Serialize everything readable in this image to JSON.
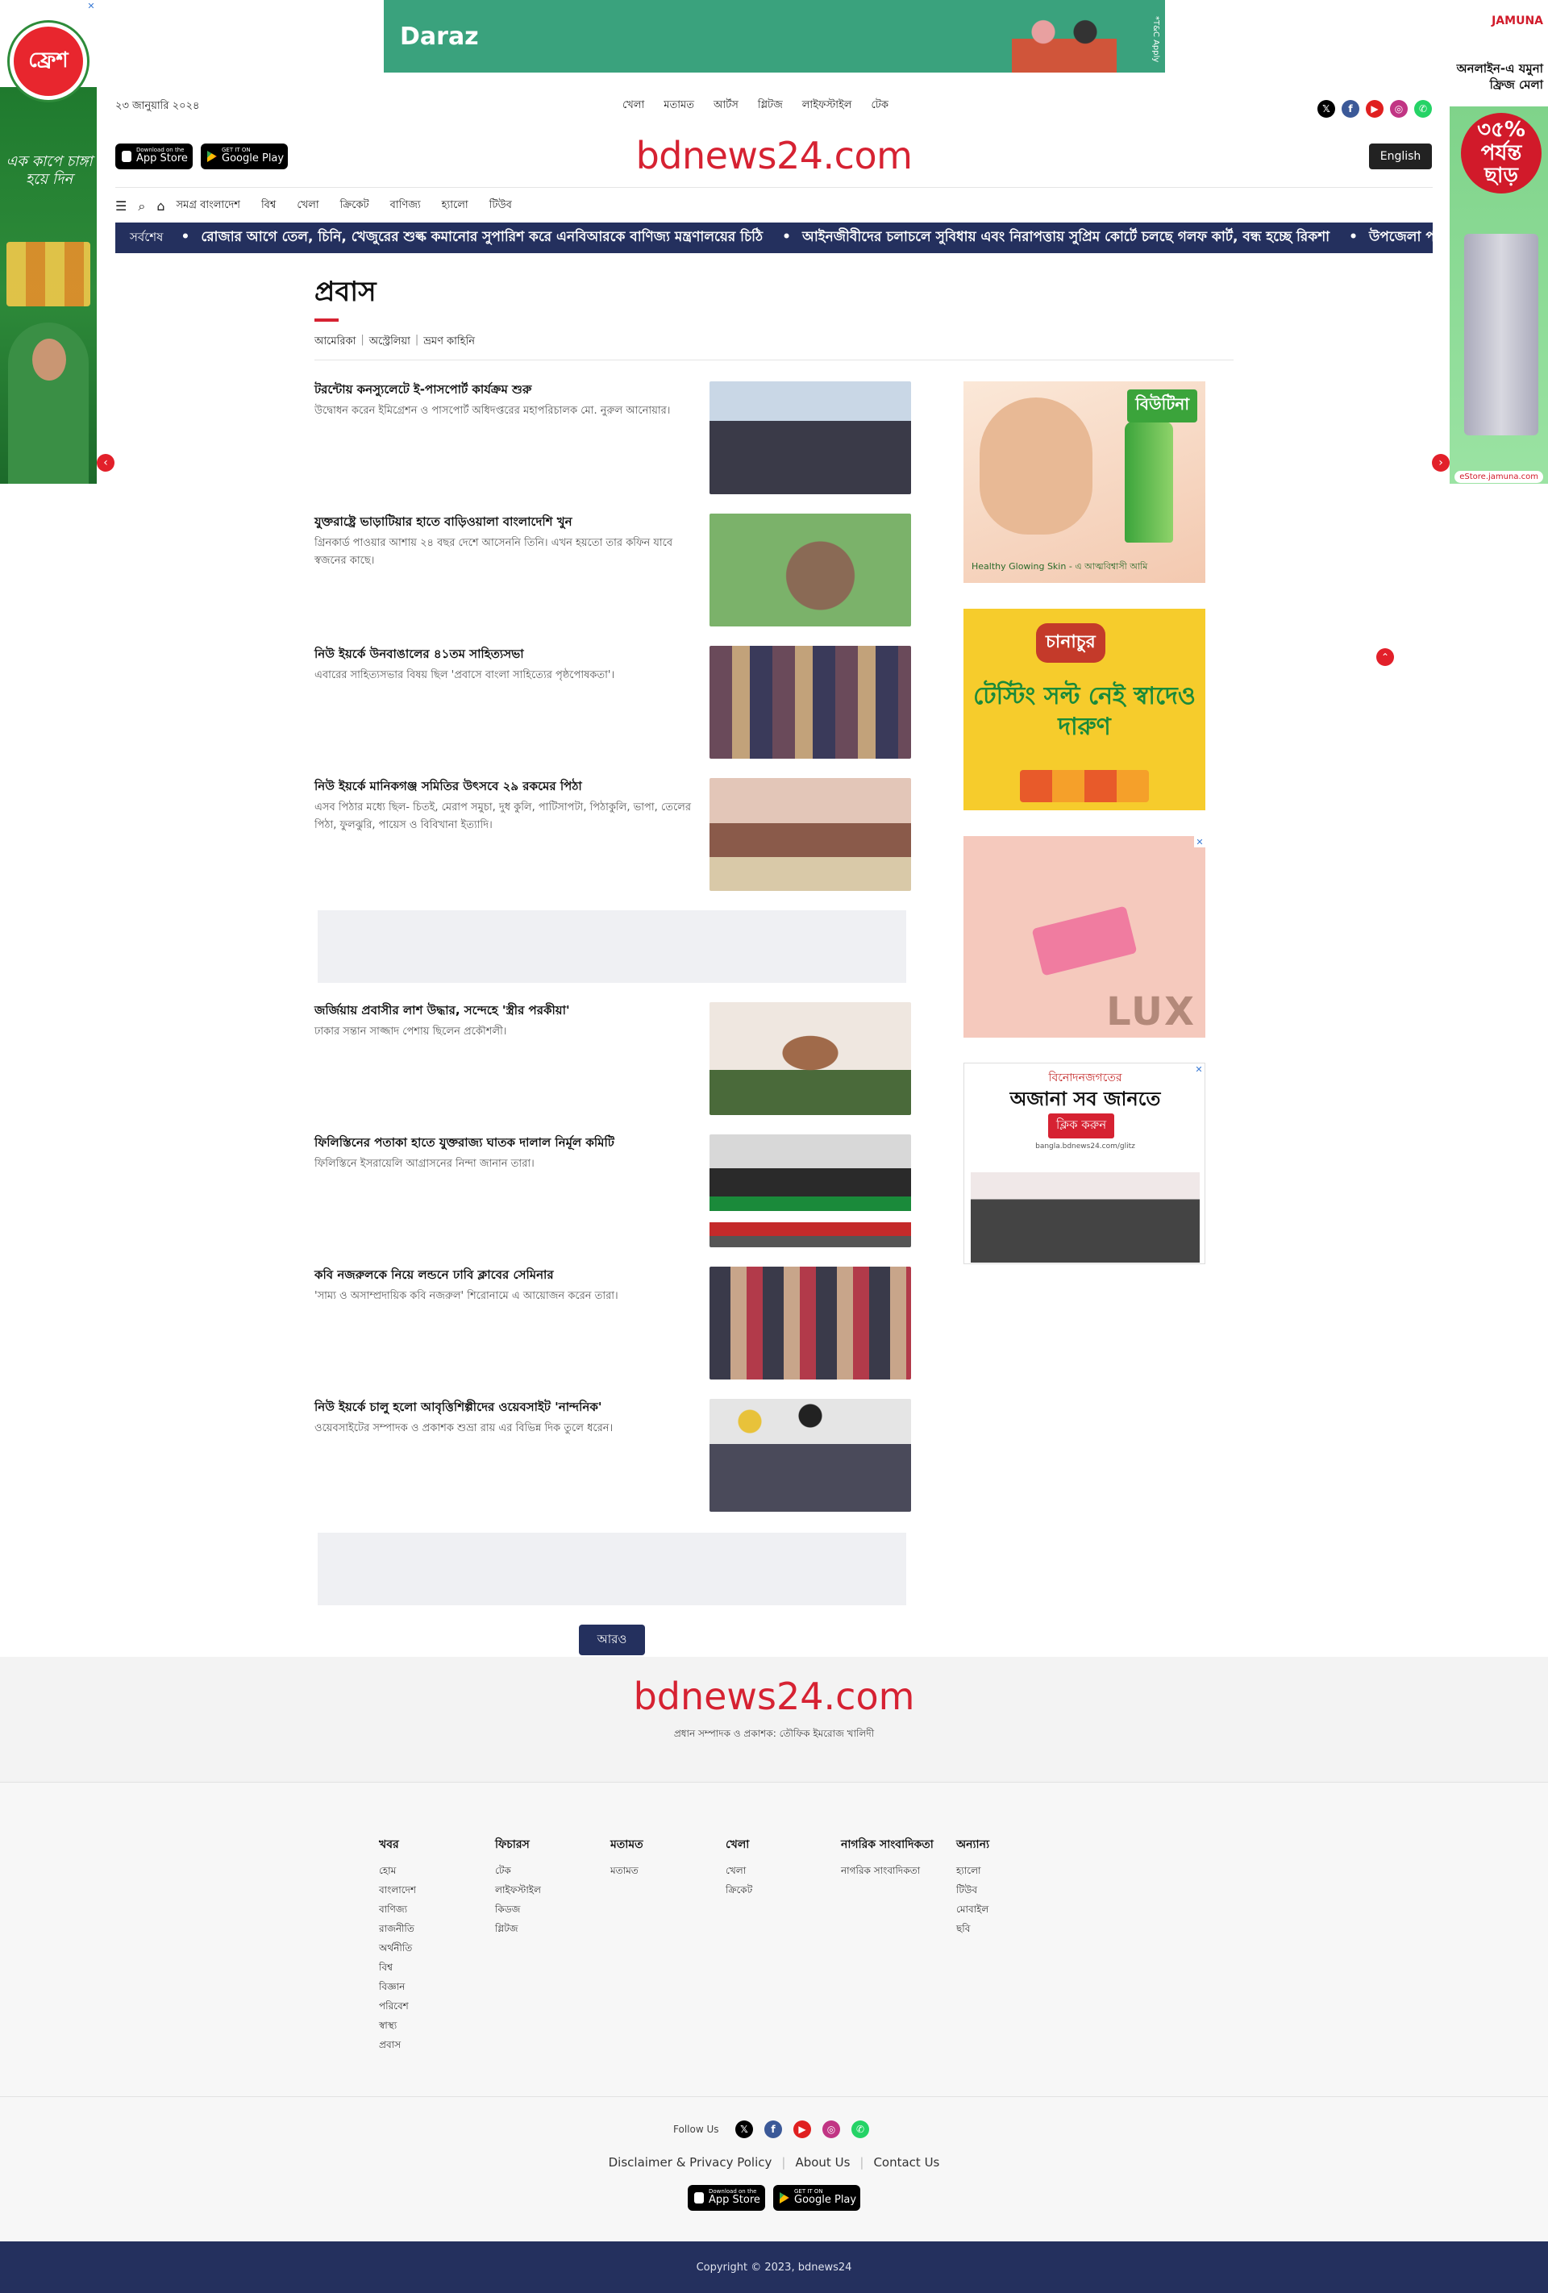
{
  "ads": {
    "top_banner": {
      "brand": "Daraz",
      "tc": "*T&C Apply"
    },
    "left_skyscraper": {
      "brand": "ফ্রেশ",
      "tagline": "এক কাপে চাঙ্গা হয়ে দিন"
    },
    "right_skyscraper": {
      "brand": "JAMUNA",
      "headline": "অনলাইন-এ যমুনা ফ্রিজ মেলা",
      "offer": "৩৫% পর্যন্ত ছাড়",
      "link": "eStore.jamuna.com"
    },
    "rail_1": {
      "brand": "বিউটিনা",
      "caption": "Healthy Glowing Skin - এ আত্মবিশ্বাসী আমি"
    },
    "rail_2": {
      "brand": "চানাচুর",
      "text": "টেস্টিং সল্ট নেই স্বাদেও দারুণ"
    },
    "rail_3": {
      "brand": "LUX"
    },
    "rail_4": {
      "kicker": "বিনোদনজগতের",
      "headline": "অজানা সব জানতে",
      "cta": "ক্লিক করুন",
      "url": "bangla.bdnews24.com/glitz"
    }
  },
  "header": {
    "date": "২৩ জানুয়ারি ২০২৪",
    "top_links": [
      "খেলা",
      "মতামত",
      "আর্টস",
      "গ্লিটজ",
      "লাইফস্টাইল",
      "টেক"
    ],
    "brand": "bdnews24.com",
    "language_button": "English",
    "app_store": {
      "small": "Download on the",
      "big": "App Store"
    },
    "google_play": {
      "small": "GET IT ON",
      "big": "Google Play"
    }
  },
  "nav": {
    "items": [
      "সমগ্র বাংলাদেশ",
      "বিশ্ব",
      "খেলা",
      "ক্রিকেট",
      "বাণিজ্য",
      "হ্যালো",
      "টিউব"
    ]
  },
  "ticker": {
    "lead": "সর্বশেষ",
    "items": [
      "রোজার আগে তেল, চিনি, খেজুরের শুল্ক কমানোর সুপারিশ করে এনবিআরকে বাণিজ্য মন্ত্রণালয়ের চিঠি",
      "আইনজীবীদের চলাচলে সুবিধায় এবং নিরাপত্তায় সুপ্রিম কোর্টে চলছে গলফ কার্ট, বন্ধ হচ্ছে রিকশা",
      "উপজেলা পরিষদের ভোট ইভেম"
    ]
  },
  "section": {
    "title": "প্রবাস",
    "subnav": [
      "আমেরিকা",
      "অস্ট্রেলিয়া",
      "ভ্রমণ কাহিনি"
    ]
  },
  "stories": [
    {
      "title": "টরন্টোয় কনস্যুলেটে ই-পাসপোর্ট কার্যক্রম শুরু",
      "summary": "উদ্বোধন করেন ইমিগ্রেশন ও পাসপোর্ট অধিদপ্তরের মহাপরিচালক মো. নুরুল আনোয়ার।"
    },
    {
      "title": "যুক্তরাষ্ট্রে ভাড়াটিয়ার হাতে বাড়িওয়ালা বাংলাদেশি খুন",
      "summary": "গ্রিনকার্ড পাওয়ার আশায় ২৪ বছর দেশে আসেননি তিনি। এখন হয়তো তার কফিন যাবে স্বজনের কাছে।"
    },
    {
      "title": "নিউ ইয়র্কে উনবাঙালের ৪১তম সাহিত্যসভা",
      "summary": "এবারের সাহিত্যসভার বিষয় ছিল 'প্রবাসে বাংলা সাহিত্যের পৃষ্ঠপোষকতা'।"
    },
    {
      "title": "নিউ ইয়র্কে মানিকগঞ্জ সমিতির উৎসবে ২৯ রকমের পিঠা",
      "summary": "এসব পিঠার মধ্যে ছিল- চিতই, মেরাপ সমুচা, দুধ কুলি, পাটিসাপটা, পিঠাকুলি, ভাপা, তেলের পিঠা, ফুলঝুরি, পায়েস ও বিবিখানা ইত্যাদি।"
    },
    {
      "title": "জর্জিয়ায় প্রবাসীর লাশ উদ্ধার, সন্দেহে 'স্ত্রীর পরকীয়া'",
      "summary": "ঢাকার সন্তান সাজ্জাদ পেশায় ছিলেন প্রকৌশলী।"
    },
    {
      "title": "ফিলিস্তিনের পতাকা হাতে যুক্তরাজ্য ঘাতক দালাল নির্মূল কমিটি",
      "summary": "ফিলিস্তিনে ইসরায়েলি আগ্রাসনের নিন্দা জানান তারা।"
    },
    {
      "title": "কবি নজরুলকে নিয়ে লন্ডনে ঢাবি ক্লাবের সেমিনার",
      "summary": "'সাম্য ও অসাম্প্রদায়িক কবি নজরুল' শিরোনামে এ আয়োজন করেন তারা।"
    },
    {
      "title": "নিউ ইয়র্কে চালু হলো আবৃত্তিশিল্পীদের ওয়েবসাইট 'নান্দনিক'",
      "summary": "ওয়েবসাইটের সম্পাদক ও প্রকাশক শুভ্রা রায় এর বিভিন্ন দিক তুলে ধরেন।"
    }
  ],
  "more_button": "আরও",
  "footer": {
    "brand": "bdnews24.com",
    "editor": "প্রধান সম্পাদক ও প্রকাশক: তৌফিক ইমরোজ খালিদী",
    "columns": [
      {
        "title": "খবর",
        "links": [
          "হোম",
          "বাংলাদেশ",
          "বাণিজ্য",
          "রাজনীতি",
          "অর্থনীতি",
          "বিশ্ব",
          "বিজ্ঞান",
          "পরিবেশ",
          "স্বাস্থ্য",
          "প্রবাস"
        ]
      },
      {
        "title": "ফিচারস",
        "links": [
          "টেক",
          "লাইফস্টাইল",
          "কিডজ",
          "গ্লিটজ"
        ]
      },
      {
        "title": "মতামত",
        "links": [
          "মতামত"
        ]
      },
      {
        "title": "খেলা",
        "links": [
          "খেলা",
          "ক্রিকেট"
        ]
      },
      {
        "title": "নাগরিক সাংবাদিকতা",
        "links": [
          "নাগরিক সাংবাদিকতা"
        ]
      },
      {
        "title": "অন্যান্য",
        "links": [
          "হ্যালো",
          "টিউব",
          "মোবাইল",
          "ছবি"
        ]
      }
    ],
    "follow_label": "Follow Us",
    "links": [
      "Disclaimer & Privacy Policy",
      "About Us",
      "Contact Us"
    ],
    "copyright": "Copyright © 2023, bdnews24"
  },
  "colors": {
    "brand_red": "#d62232",
    "navy": "#24305e"
  },
  "icons": [
    "x-icon",
    "facebook-icon",
    "youtube-icon",
    "instagram-icon",
    "whatsapp-icon",
    "menu-icon",
    "search-icon",
    "home-icon",
    "apple-icon",
    "google-play-icon"
  ]
}
